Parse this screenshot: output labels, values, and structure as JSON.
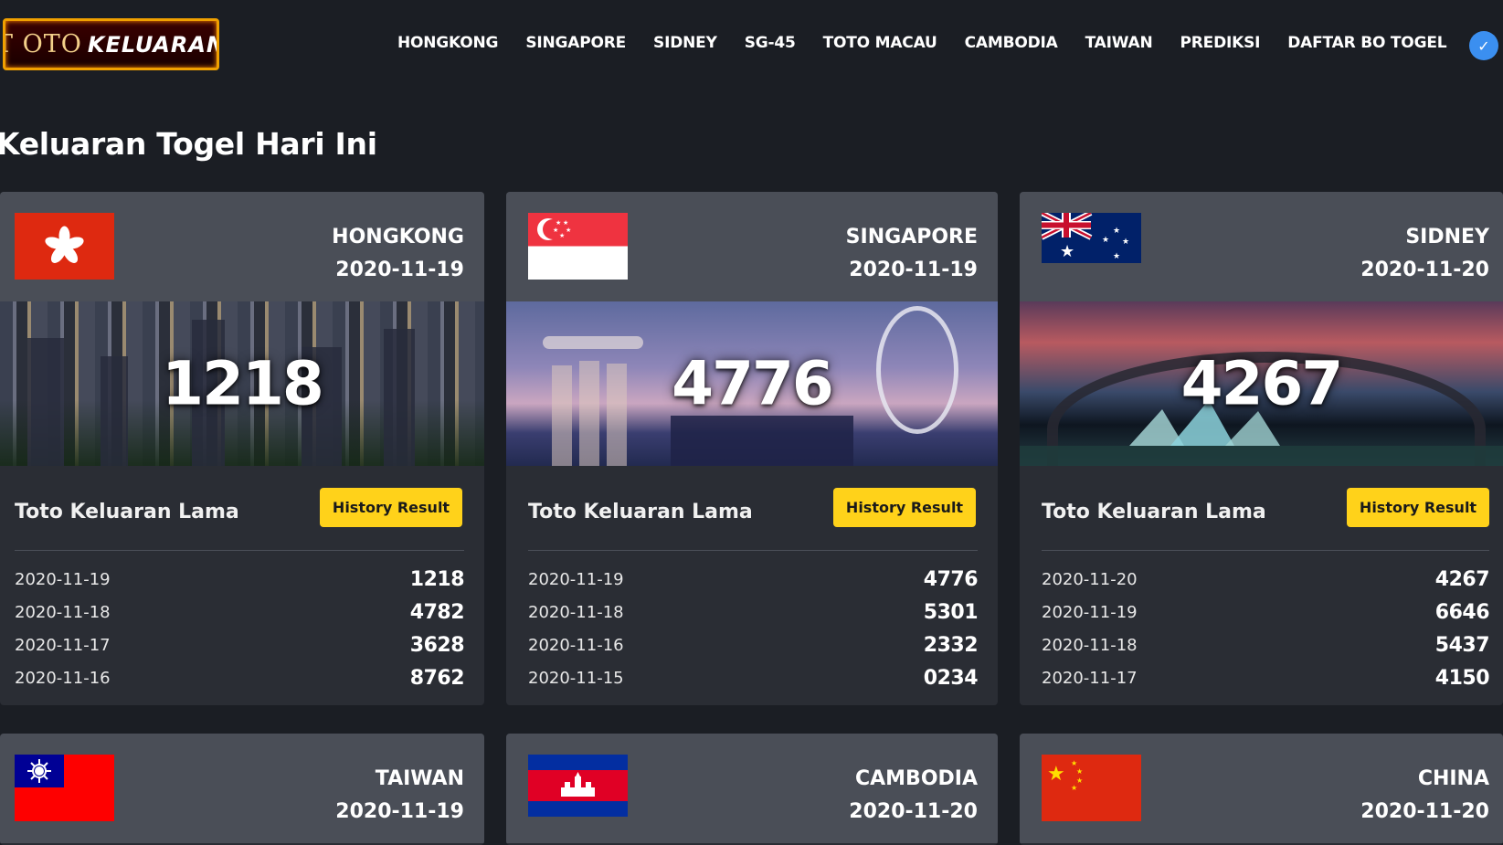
{
  "header": {
    "logo_part1": "T OTO",
    "logo_part2": "KELUARAN",
    "nav": [
      "HONGKONG",
      "SINGAPORE",
      "SIDNEY",
      "SG-45",
      "TOTO MACAU",
      "CAMBODIA",
      "TAIWAN",
      "PREDIKSI",
      "DAFTAR BO TOGEL"
    ],
    "verified_icon": "verified-badge-icon"
  },
  "page_title": "Keluaran Togel Hari Ini",
  "cards": [
    {
      "name": "HONGKONG",
      "date": "2020-11-19",
      "number": "1218",
      "old_title": "Toto Keluaran Lama",
      "button": "History Result",
      "rows": [
        {
          "date": "2020-11-19",
          "value": "1218"
        },
        {
          "date": "2020-11-18",
          "value": "4782"
        },
        {
          "date": "2020-11-17",
          "value": "3628"
        },
        {
          "date": "2020-11-16",
          "value": "8762"
        }
      ]
    },
    {
      "name": "SINGAPORE",
      "date": "2020-11-19",
      "number": "4776",
      "old_title": "Toto Keluaran Lama",
      "button": "History Result",
      "rows": [
        {
          "date": "2020-11-19",
          "value": "4776"
        },
        {
          "date": "2020-11-18",
          "value": "5301"
        },
        {
          "date": "2020-11-16",
          "value": "2332"
        },
        {
          "date": "2020-11-15",
          "value": "0234"
        }
      ]
    },
    {
      "name": "SIDNEY",
      "date": "2020-11-20",
      "number": "4267",
      "old_title": "Toto Keluaran Lama",
      "button": "History Result",
      "rows": [
        {
          "date": "2020-11-20",
          "value": "4267"
        },
        {
          "date": "2020-11-19",
          "value": "6646"
        },
        {
          "date": "2020-11-18",
          "value": "5437"
        },
        {
          "date": "2020-11-17",
          "value": "4150"
        }
      ]
    }
  ],
  "bottom_cards": [
    {
      "name": "TAIWAN",
      "date": "2020-11-19"
    },
    {
      "name": "CAMBODIA",
      "date": "2020-11-20"
    },
    {
      "name": "CHINA",
      "date": "2020-11-20"
    }
  ],
  "colors": {
    "background": "#1b1e24",
    "card_header": "#4a4e57",
    "card_body": "#2a2d34",
    "button": "#ffd21a"
  }
}
